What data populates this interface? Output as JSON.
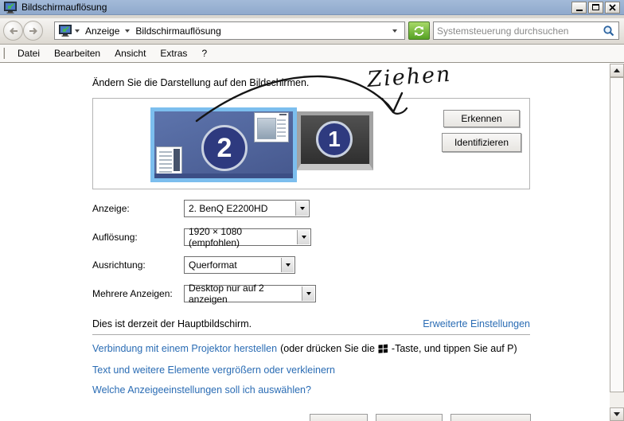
{
  "window": {
    "title": "Bildschirmauflösung"
  },
  "toolbar": {
    "breadcrumb_root": "Anzeige",
    "breadcrumb_page": "Bildschirmauflösung",
    "search_placeholder": "Systemsteuerung durchsuchen"
  },
  "menubar": {
    "items": [
      {
        "label": "Datei"
      },
      {
        "label": "Bearbeiten"
      },
      {
        "label": "Ansicht"
      },
      {
        "label": "Extras"
      },
      {
        "label": "?"
      }
    ]
  },
  "main": {
    "heading": "Ändern Sie die Darstellung auf den Bildschirmen.",
    "annotation_text": "Ziehen",
    "monitor_primary_number": "2",
    "monitor_secondary_number": "1",
    "detect_button": "Erkennen",
    "identify_button": "Identifizieren",
    "fields": [
      {
        "label": "Anzeige:",
        "value": "2. BenQ E2200HD"
      },
      {
        "label": "Auflösung:",
        "value": "1920 × 1080 (empfohlen)"
      },
      {
        "label": "Ausrichtung:",
        "value": "Querformat"
      },
      {
        "label": "Mehrere Anzeigen:",
        "value": "Desktop nur auf 2 anzeigen"
      }
    ],
    "primary_note": "Dies ist derzeit der Hauptbildschirm.",
    "advanced_settings_link": "Erweiterte Einstellungen",
    "projector_link": "Verbindung mit einem Projektor herstellen",
    "projector_hint_prefix": "(oder drücken Sie die",
    "projector_hint_suffix": "-Taste, und tippen Sie auf P)",
    "dpi_link": "Text und weitere Elemente vergrößern oder verkleinern",
    "help_link": "Welche Anzeigeeinstellungen soll ich auswählen?"
  },
  "colors": {
    "titlebar_blue": "#99b1d2",
    "selection_blue": "#7cbeee",
    "monitor_screen_blue": "#50659f",
    "monitor_circle_navy": "#2e3a7f",
    "link_blue": "#2a6cb4",
    "refresh_green": "#55a223"
  }
}
